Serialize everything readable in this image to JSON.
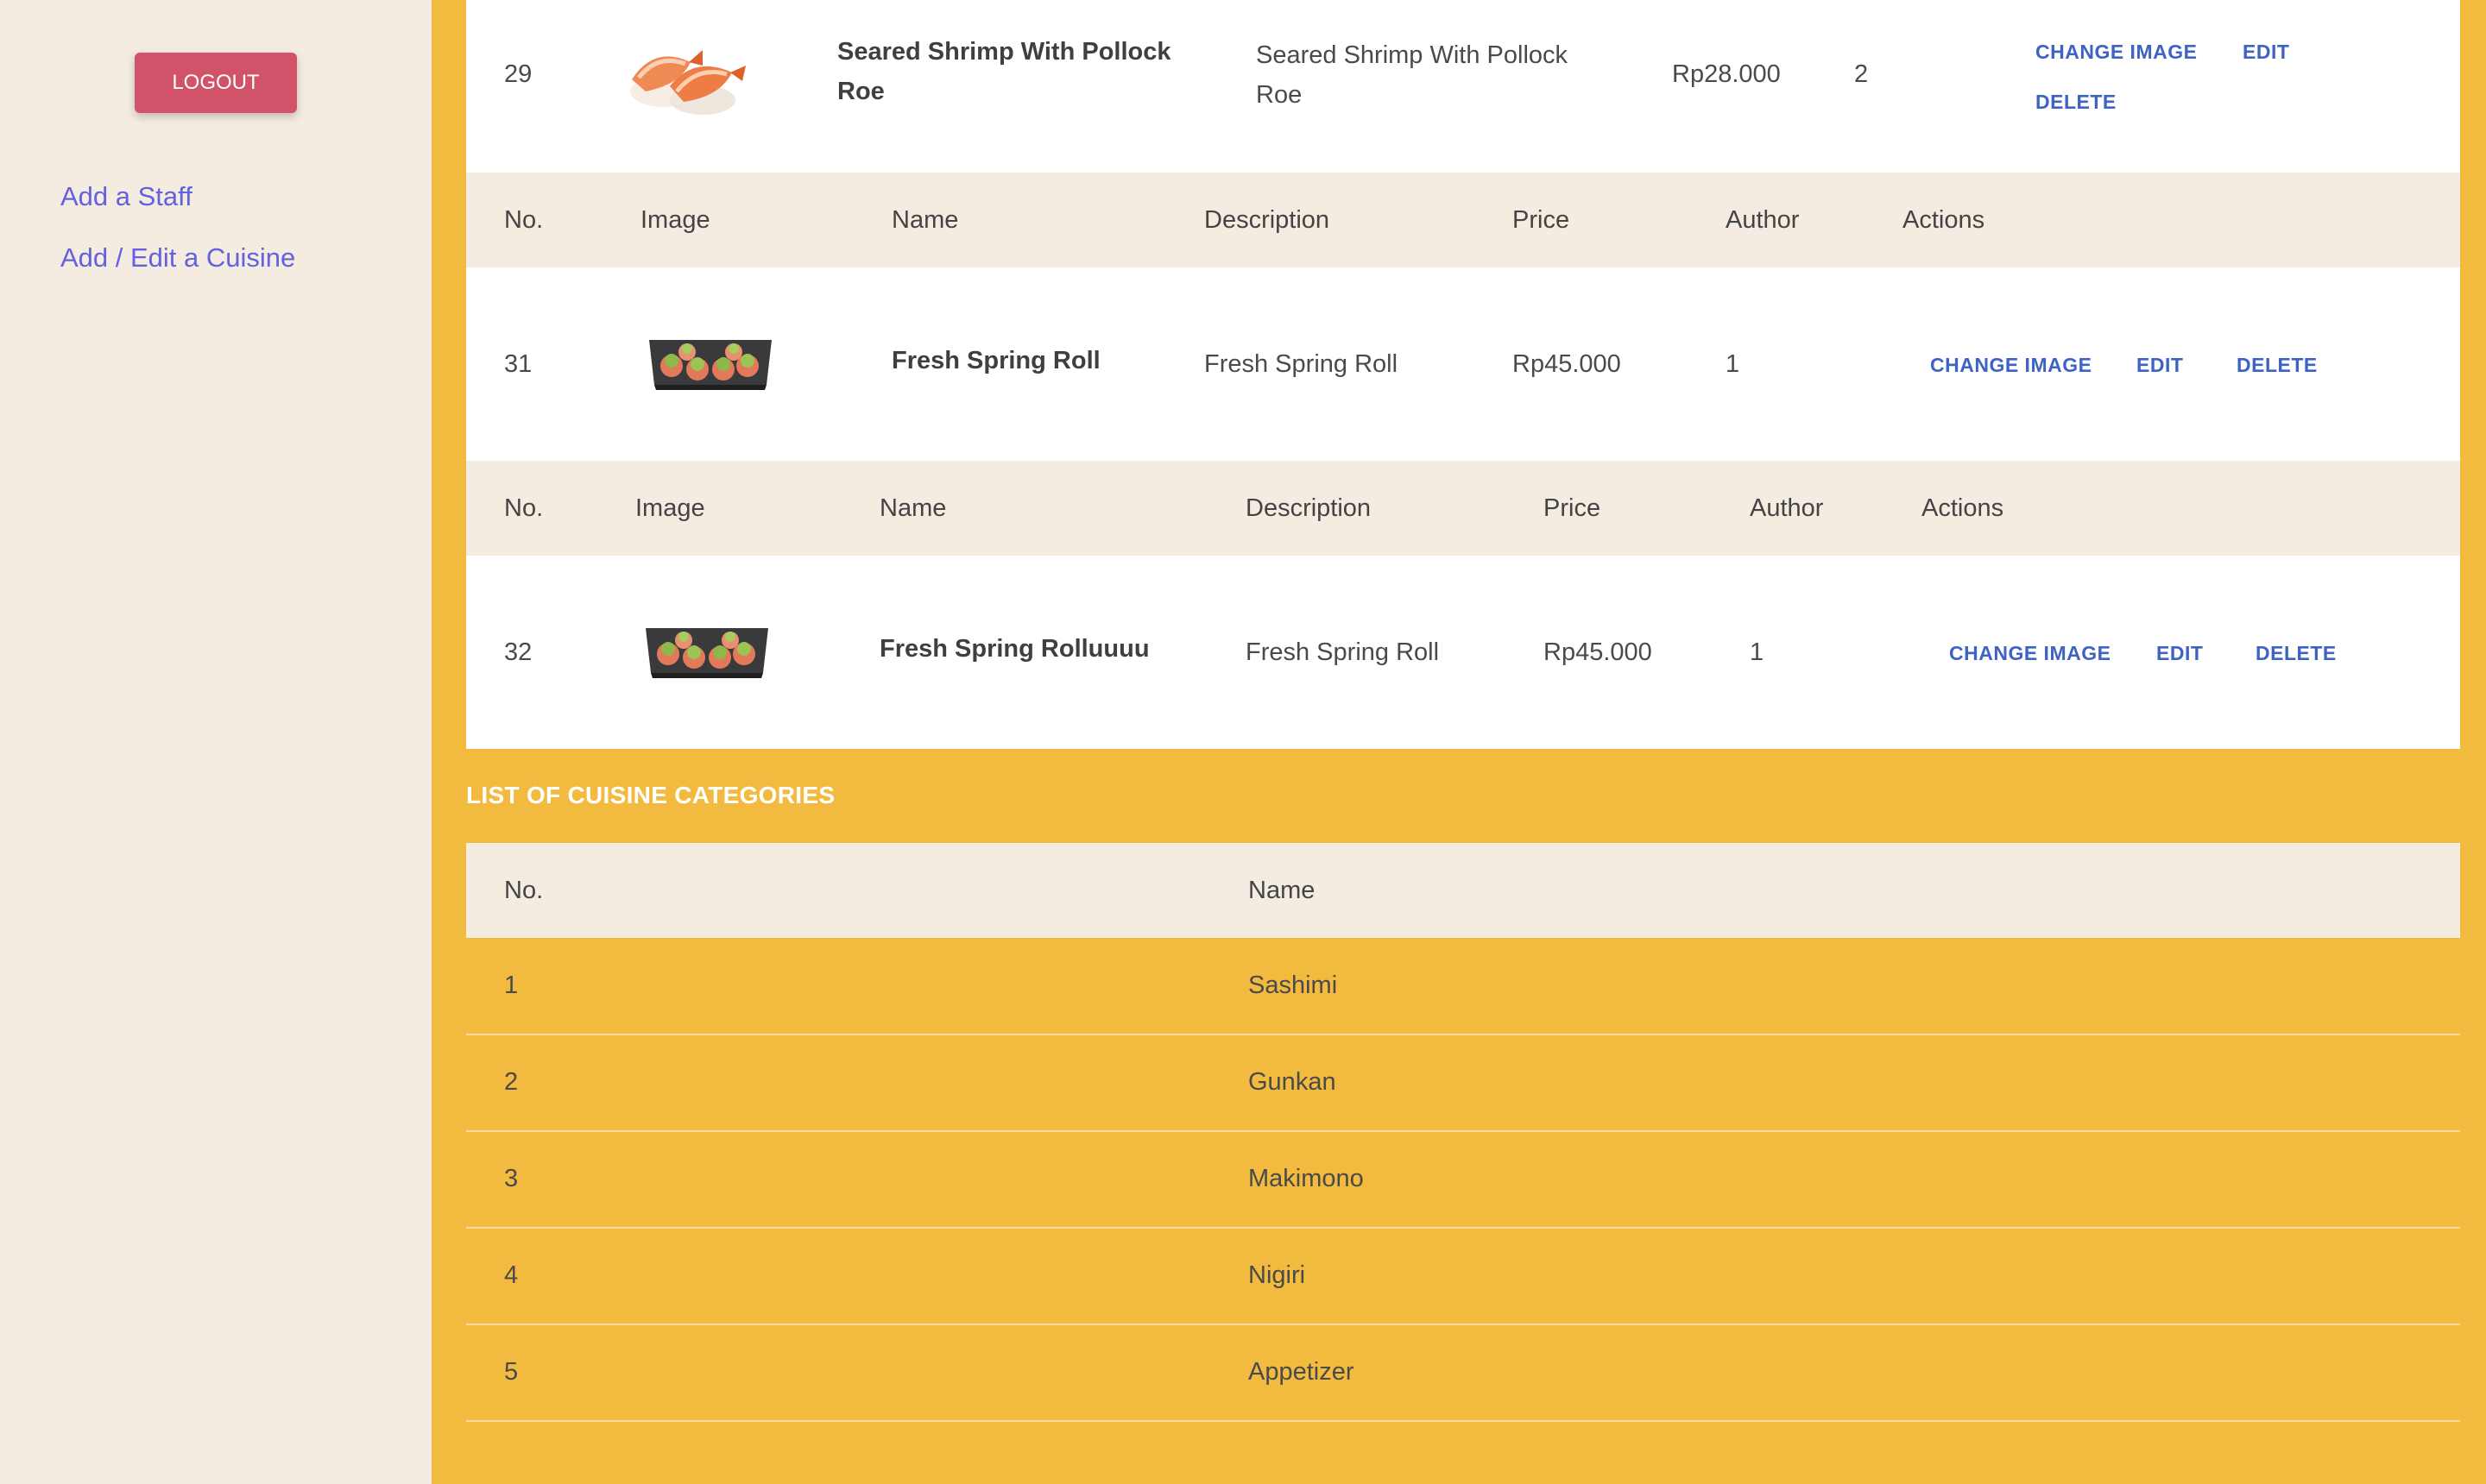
{
  "sidebar": {
    "logout_label": "LOGOUT",
    "links": [
      "Add a Staff",
      "Add / Edit a Cuisine"
    ]
  },
  "headers": {
    "no": "No.",
    "image": "Image",
    "name": "Name",
    "description": "Description",
    "price": "Price",
    "author": "Author",
    "actions": "Actions"
  },
  "cuisines": [
    {
      "no": "29",
      "image_icon": "shrimp-sushi-image",
      "name_line1": "Seared Shrimp With Pollock",
      "name_line2": "Roe",
      "desc_line1": "Seared Shrimp With Pollock",
      "desc_line2": "Roe",
      "price": "Rp28.000",
      "author": "2"
    },
    {
      "no": "31",
      "image_icon": "spring-roll-plate-image",
      "name": "Fresh Spring Roll",
      "description": "Fresh Spring Roll",
      "price": "Rp45.000",
      "author": "1"
    },
    {
      "no": "32",
      "image_icon": "spring-roll-plate-image",
      "name": "Fresh Spring Rolluuuu",
      "description": "Fresh Spring Roll",
      "price": "Rp45.000",
      "author": "1"
    }
  ],
  "actions": {
    "change_image": "CHANGE IMAGE",
    "edit": "EDIT",
    "delete": "DELETE"
  },
  "categories": {
    "title": "LIST OF CUISINE CATEGORIES",
    "headers": {
      "no": "No.",
      "name": "Name"
    },
    "rows": [
      {
        "no": "1",
        "name": "Sashimi"
      },
      {
        "no": "2",
        "name": "Gunkan"
      },
      {
        "no": "3",
        "name": "Makimono"
      },
      {
        "no": "4",
        "name": "Nigiri"
      },
      {
        "no": "5",
        "name": "Appetizer"
      }
    ]
  },
  "colors": {
    "page_background": "#f2bb3f",
    "sidebar_background": "#f4ece1",
    "logout_button": "#d0536a",
    "link": "#6461e0",
    "action_link": "#3e63c3"
  }
}
